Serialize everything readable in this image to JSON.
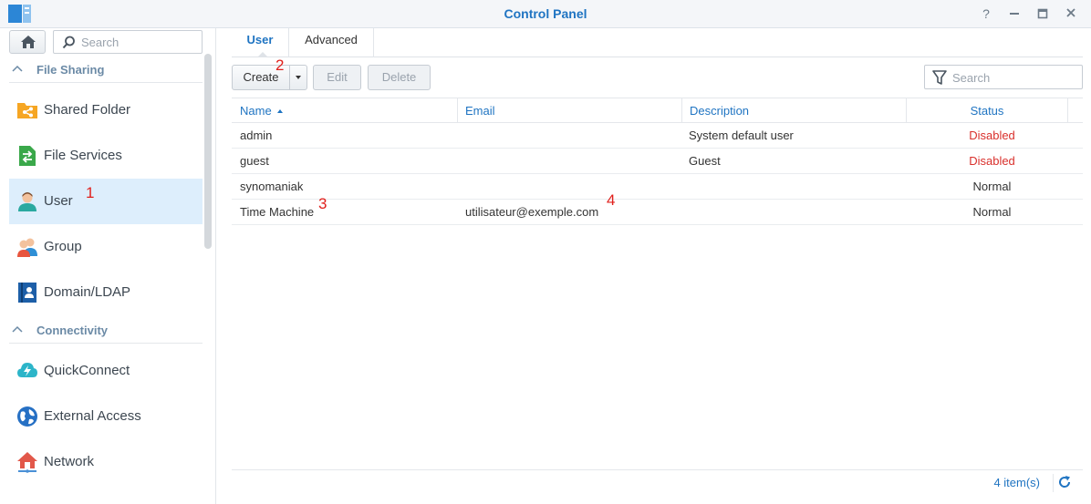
{
  "window": {
    "title": "Control Panel",
    "controls": [
      "help-icon",
      "minimize-icon",
      "maximize-icon",
      "close-icon"
    ]
  },
  "sidebar": {
    "search_placeholder": "Search",
    "sections": [
      {
        "label": "File Sharing"
      },
      {
        "label": "Connectivity"
      }
    ],
    "items": [
      {
        "label": "Shared Folder",
        "icon": "shared-folder-icon"
      },
      {
        "label": "File Services",
        "icon": "file-services-icon"
      },
      {
        "label": "User",
        "icon": "user-icon",
        "active": true
      },
      {
        "label": "Group",
        "icon": "group-icon"
      },
      {
        "label": "Domain/LDAP",
        "icon": "domain-ldap-icon"
      },
      {
        "label": "QuickConnect",
        "icon": "quickconnect-icon"
      },
      {
        "label": "External Access",
        "icon": "external-access-icon"
      },
      {
        "label": "Network",
        "icon": "network-icon"
      }
    ]
  },
  "tabs": [
    {
      "label": "User",
      "active": true
    },
    {
      "label": "Advanced"
    }
  ],
  "toolbar": {
    "create_label": "Create",
    "edit_label": "Edit",
    "delete_label": "Delete",
    "search_placeholder": "Search"
  },
  "table": {
    "columns": [
      "Name",
      "Email",
      "Description",
      "Status"
    ],
    "rows": [
      {
        "name": "admin",
        "email": "",
        "description": "System default user",
        "status": "Disabled"
      },
      {
        "name": "guest",
        "email": "",
        "description": "Guest",
        "status": "Disabled"
      },
      {
        "name": "synomaniak",
        "email": "",
        "description": "",
        "status": "Normal"
      },
      {
        "name": "Time Machine",
        "email": "utilisateur@exemple.com",
        "description": "",
        "status": "Normal"
      }
    ]
  },
  "footer": {
    "count": "4 item(s)"
  },
  "annotations": [
    "1",
    "2",
    "3",
    "4"
  ],
  "colors": {
    "accent": "#1f74c2",
    "disabled_status": "#d9302c",
    "active_item_bg": "#ddeefc"
  }
}
